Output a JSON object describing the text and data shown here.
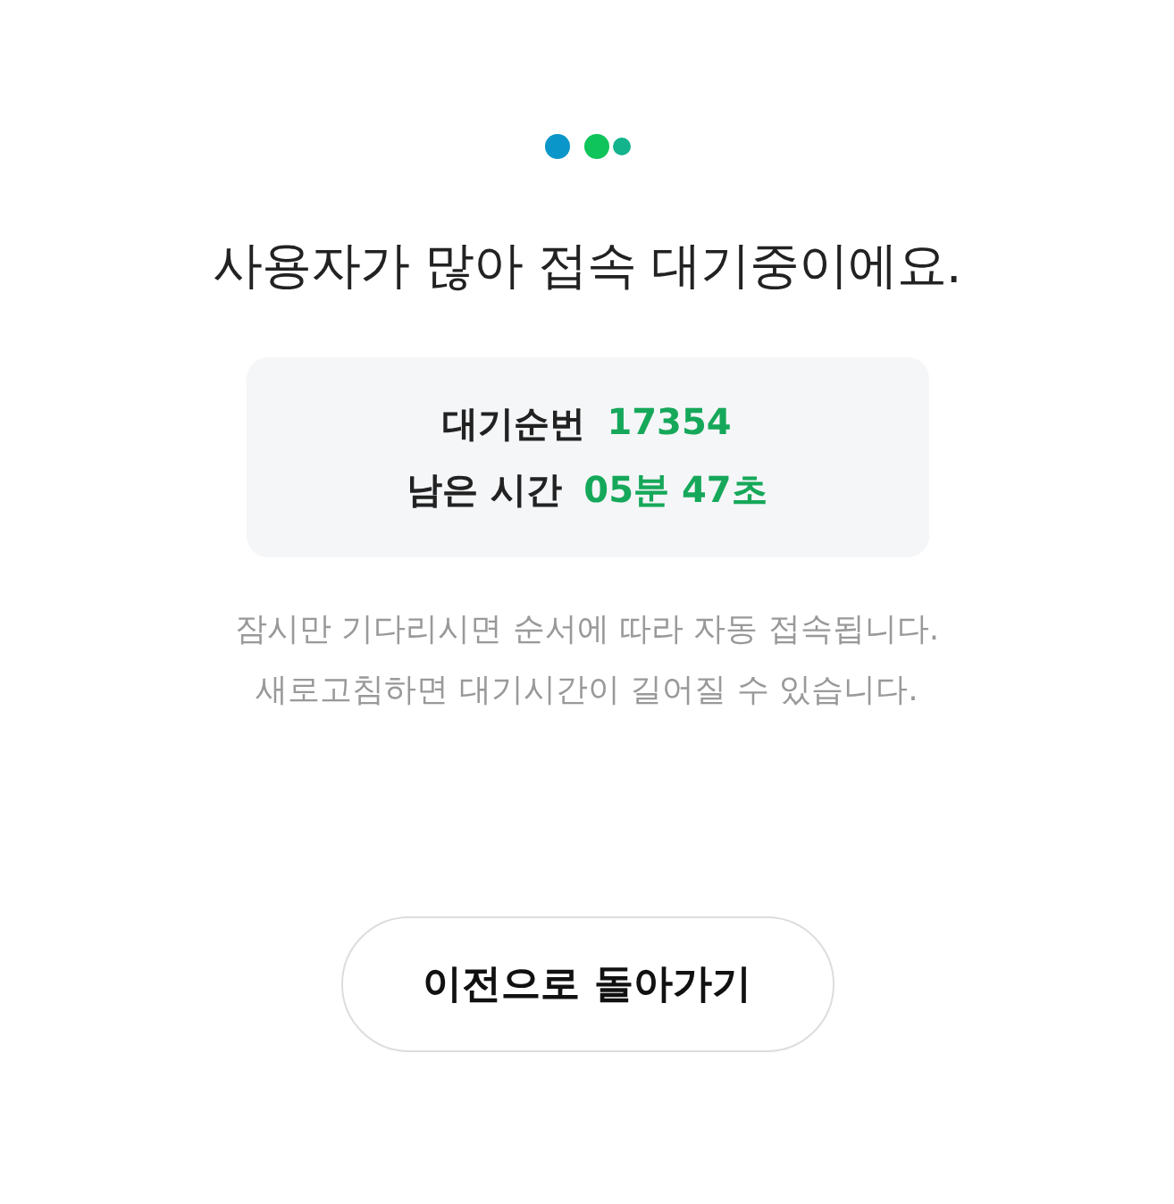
{
  "title": "사용자가 많아 접속 대기중이에요.",
  "queue": [
    {
      "label": "대기순번",
      "value": "17354"
    },
    {
      "label": "남은 시간",
      "value": "05분 47초"
    }
  ],
  "messages": [
    "잠시만 기다리시면 순서에 따라 자동 접속됩니다.",
    "새로고침하면 대기시간이 길어질 수 있습니다."
  ],
  "button": "이전으로 돌아가기"
}
